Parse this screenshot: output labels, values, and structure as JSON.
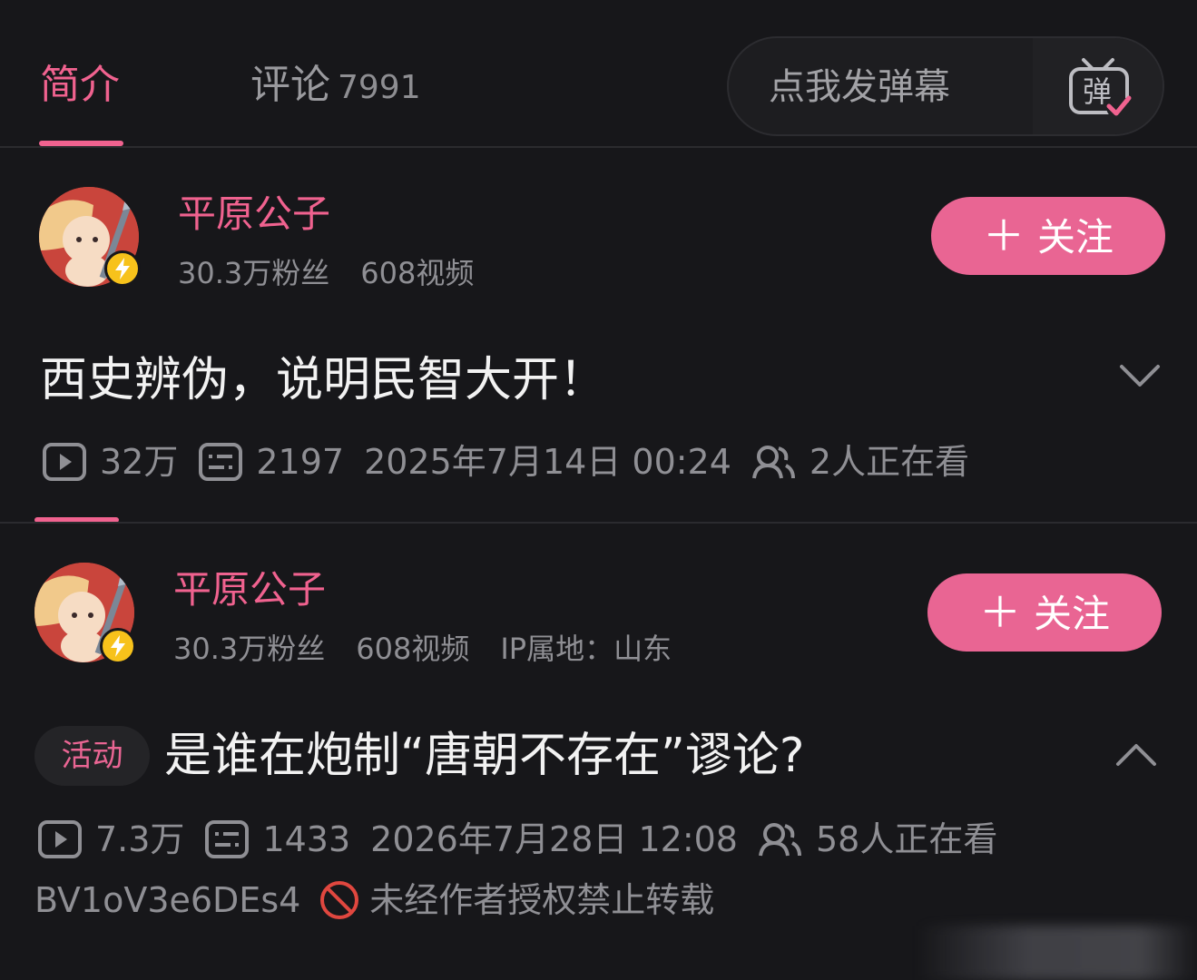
{
  "tabs": {
    "intro_label": "简介",
    "comments_label": "评论",
    "comments_count": "7991"
  },
  "danmaku": {
    "input_placeholder": "点我发弹幕",
    "button_icon": "danmaku-toggle-icon",
    "button_glyph": "弹"
  },
  "videos": [
    {
      "author": {
        "name": "平原公子",
        "fans": "30.3万粉丝",
        "videos": "608视频",
        "ip": ""
      },
      "follow_label": "关注",
      "title": "西史辨伪，说明民智大开！",
      "stats": {
        "views": "32万",
        "danmaku": "2197",
        "date": "2025年7月14日 00:24",
        "watching": "2人正在看"
      }
    },
    {
      "author": {
        "name": "平原公子",
        "fans": "30.3万粉丝",
        "videos": "608视频",
        "ip": "IP属地：山东"
      },
      "follow_label": "关注",
      "tag": "活动",
      "title": "是谁在炮制“唐朝不存在”谬论?",
      "stats": {
        "views": "7.3万",
        "danmaku": "1433",
        "date": "2026年7月28日 12:08",
        "watching": "58人正在看"
      },
      "bvid": "BV1oV3e6DEs4",
      "repost_notice": "未经作者授权禁止转载"
    }
  ],
  "colors": {
    "accent": "#f0628f",
    "follow_bg": "#e96593",
    "background": "#17171a",
    "muted_text": "#8f8f94",
    "badge_yellow": "#f7c21b",
    "notice_red": "#e0473f"
  }
}
